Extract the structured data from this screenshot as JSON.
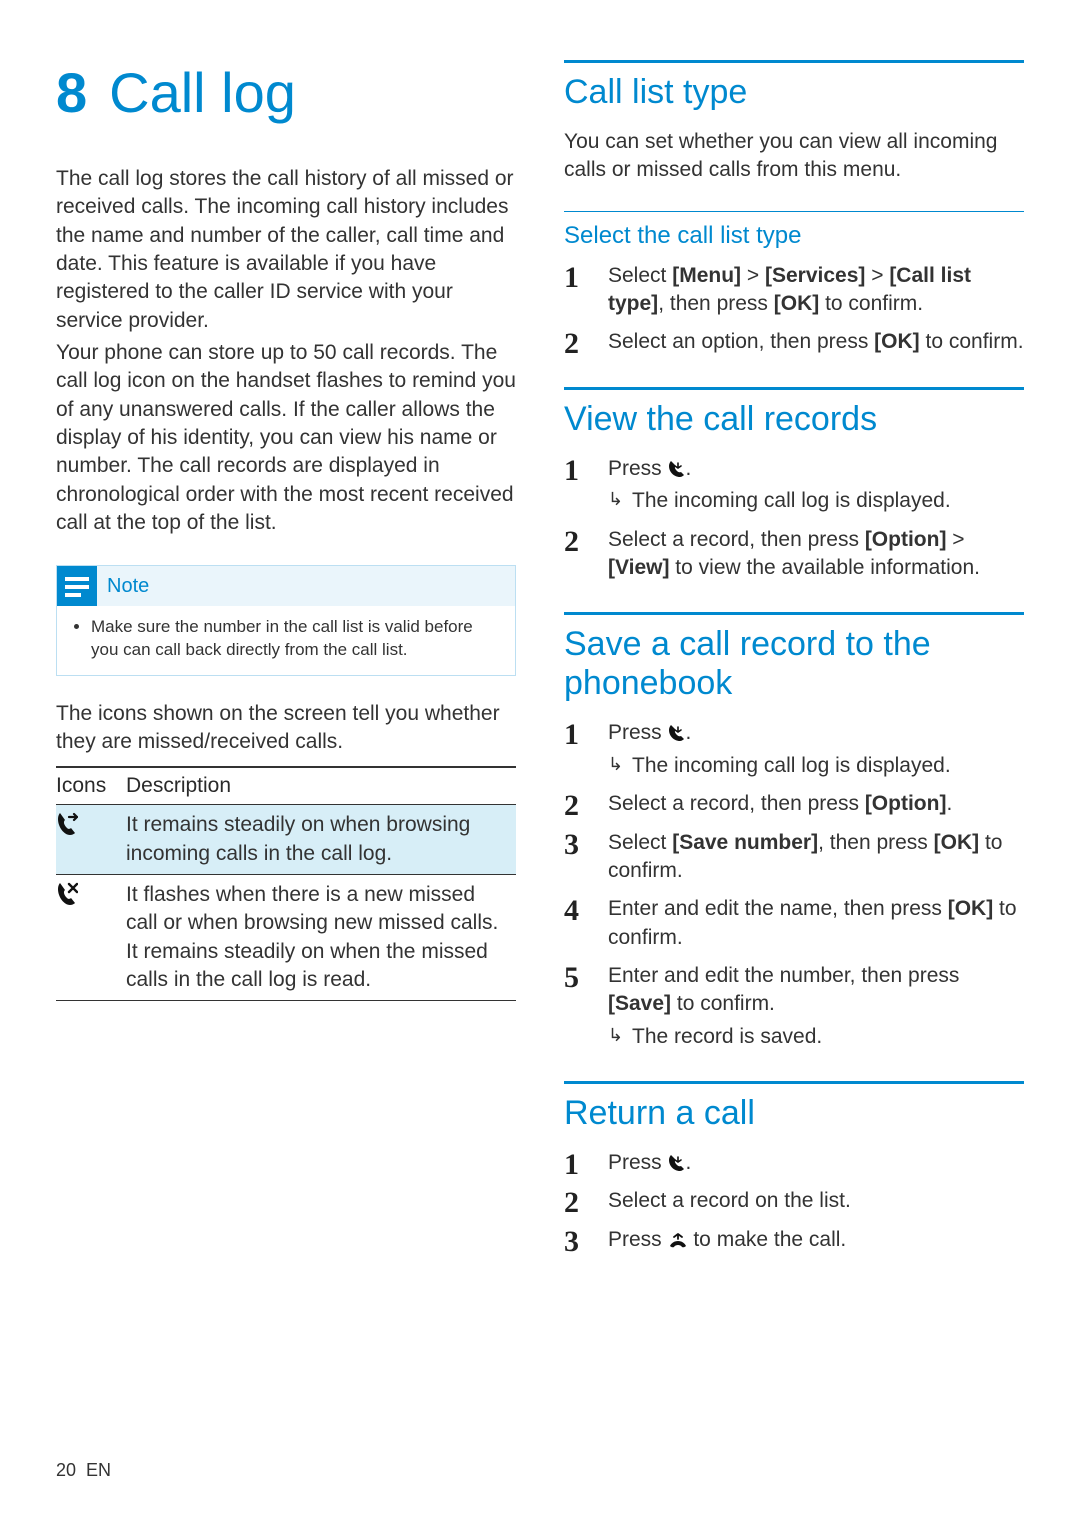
{
  "chapter": {
    "number": "8",
    "title": "Call log"
  },
  "left": {
    "p1": "The call log stores the call history of all missed or received calls. The incoming call history includes the name and number of the caller, call time and date. This feature is available if you have registered to the caller ID service with your service provider.",
    "p2": "Your phone can store up to 50 call records. The call log icon on the handset flashes to remind you of any unanswered calls. If the caller allows the display of his identity, you can view his name or number. The call records are displayed in chronological order with the most recent received call at the top of the list.",
    "note_label": "Note",
    "note_text": "Make sure the number in the call list is valid before you can call back directly from the call list.",
    "p3": "The icons shown on the screen tell you whether they are missed/received calls.",
    "table": {
      "h1": "Icons",
      "h2": "Description",
      "r1": {
        "icon": "call-incoming-icon",
        "desc": "It remains steadily on when browsing incoming calls in the call log."
      },
      "r2": {
        "icon": "call-missed-icon",
        "desc": "It flashes when there is a new missed call or when browsing new missed calls. It remains steadily on when the missed calls in the call log is read."
      }
    }
  },
  "right": {
    "call_list_type": {
      "title": "Call list type",
      "intro": "You can set whether you can view all incoming calls or missed calls from this menu.",
      "sub": "Select the call list type",
      "s1_pre": "Select ",
      "s1_b1": "[Menu]",
      "s1_gt1": " > ",
      "s1_b2": "[Services]",
      "s1_gt2": " > ",
      "s1_b3": "[Call list type]",
      "s1_mid": ", then press ",
      "s1_b4": "[OK]",
      "s1_post": " to confirm.",
      "s2_pre": "Select an option, then press ",
      "s2_b1": "[OK]",
      "s2_post": " to confirm."
    },
    "view_records": {
      "title": "View the call records",
      "s1_pre": "Press ",
      "s1_post": ".",
      "s1_result": "The incoming call log is displayed.",
      "s2_pre": "Select a record, then press ",
      "s2_b1": "[Option]",
      "s2_gt": " > ",
      "s2_b2": "[View]",
      "s2_post": " to view the available information."
    },
    "save_record": {
      "title": "Save a call record to the phonebook",
      "s1_pre": "Press ",
      "s1_post": ".",
      "s1_result": "The incoming call log is displayed.",
      "s2_pre": "Select a record, then press ",
      "s2_b1": "[Option]",
      "s2_post": ".",
      "s3_pre": "Select ",
      "s3_b1": "[Save number]",
      "s3_mid": ", then press ",
      "s3_b2": "[OK]",
      "s3_post": " to confirm.",
      "s4_pre": "Enter and edit the name, then press ",
      "s4_b1": "[OK]",
      "s4_post": " to confirm.",
      "s5_pre": "Enter and edit the number, then press ",
      "s5_b1": "[Save]",
      "s5_post": " to confirm.",
      "s5_result": "The record is saved."
    },
    "return_call": {
      "title": "Return a call",
      "s1_pre": "Press ",
      "s1_post": ".",
      "s2": "Select a record on the list.",
      "s3_pre": "Press ",
      "s3_post": " to make the call."
    }
  },
  "footer": {
    "page": "20",
    "lang": "EN"
  }
}
